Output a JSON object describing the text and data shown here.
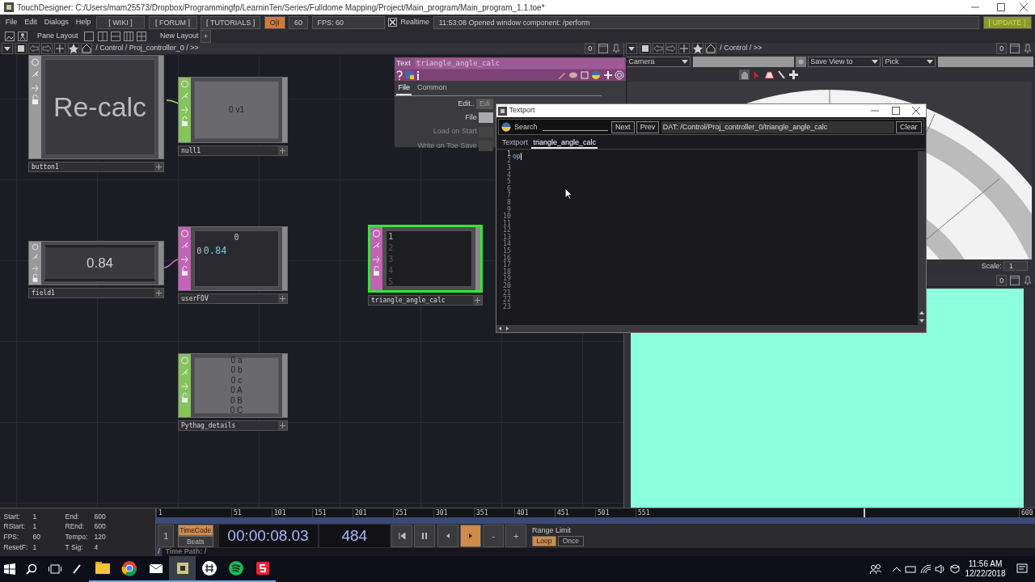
{
  "window": {
    "title": "TouchDesigner: C:/Users/mam25573/Dropbox/Programmingfp/LearninTen/Series/Fulldome Mapping/Project/Main_program/Main_program_1.1.toe*"
  },
  "menu": [
    "File",
    "Edit",
    "Dialogs",
    "Help"
  ],
  "toolbar": {
    "links": [
      "[ WIKI ]",
      "[ FORUM ]",
      "[ TUTORIALS ]"
    ],
    "perform_toggle": "O|I",
    "fps_limit": "60",
    "fps": "FPS:  60",
    "realtime": {
      "label": "Realtime",
      "checked": true
    },
    "message": "11:53:08 Opened window component: /perform",
    "update": "[ UPDATE ]"
  },
  "layout_bar": {
    "pane_layout": "Pane Layout",
    "new_layout": "New Layout",
    "add": "+"
  },
  "network": {
    "path": "/ Control / Proj_controller_0 / >>",
    "counter": "0",
    "nodes": [
      {
        "name": "button1",
        "kind": "button",
        "color": "#9a9a9a",
        "selected": false,
        "text": "Re-calc"
      },
      {
        "name": "null1",
        "kind": "chop",
        "color": "#86c35a",
        "selected": false,
        "lines": [
          "0 v1"
        ]
      },
      {
        "name": "field1",
        "kind": "field",
        "color": "#9a9a9a",
        "selected": false,
        "text": "0.84"
      },
      {
        "name": "userFOV",
        "kind": "table",
        "color": "#c263b5",
        "selected": false,
        "header": "0",
        "index": "0",
        "text": "0.84"
      },
      {
        "name": "triangle_angle_calc",
        "kind": "text",
        "color": "#c263b5",
        "selected": true,
        "lines": [
          "1",
          "2",
          "3",
          "4",
          "5"
        ]
      },
      {
        "name": "Pythag_details",
        "kind": "chop",
        "color": "#86c35a",
        "selected": false,
        "lines": [
          "0 a",
          "0 b",
          "0 c",
          "0 A",
          "0 B",
          "0 C"
        ]
      }
    ]
  },
  "parameters": {
    "type": "Text",
    "name": "triangle_angle_calc",
    "tabs": [
      {
        "label": "File",
        "selected": true
      },
      {
        "label": "Common",
        "selected": false
      }
    ],
    "rows": [
      {
        "label": "Edit..",
        "kind": "button",
        "value": "Edi",
        "disabled": false
      },
      {
        "label": "File",
        "kind": "field",
        "disabled": false
      },
      {
        "label": "Load on Start",
        "kind": "toggle",
        "disabled": true
      },
      {
        "label": "Write on Toe Save",
        "kind": "toggle",
        "disabled": true
      }
    ]
  },
  "viewer": {
    "path": "/ Control / >>",
    "counter": "0",
    "camera": "Camera",
    "save_view": "Save View to",
    "pick": "Pick",
    "scale_label": "Scale:",
    "scale": "1",
    "lower_counter": "0"
  },
  "textport": {
    "title": "Textport",
    "search_label": "Search",
    "next": "Next",
    "prev": "Prev",
    "dat_path": "DAT:  /Control/Proj_controller_0/triangle_angle_calc",
    "clear": "Clear",
    "tabs": [
      {
        "label": "Textport",
        "selected": false
      },
      {
        "label": "triangle_angle_calc",
        "selected": true
      }
    ],
    "line_numbers": [
      "1",
      "2",
      "3",
      "4",
      "5",
      "6",
      "7",
      "8",
      "9",
      "10",
      "11",
      "12",
      "13",
      "14",
      "15",
      "16",
      "17",
      "18",
      "19",
      "20",
      "21",
      "22",
      "23"
    ],
    "code": "op"
  },
  "timeline": {
    "info": [
      {
        "label": "Start:",
        "value": "1"
      },
      {
        "label": "End:",
        "value": "600"
      },
      {
        "label": "RStart:",
        "value": "1"
      },
      {
        "label": "REnd:",
        "value": "600"
      },
      {
        "label": "FPS:",
        "value": "60"
      },
      {
        "label": "Tempo:",
        "value": "120"
      },
      {
        "label": "ResetF:",
        "value": "1"
      },
      {
        "label": "T Sig:",
        "value": "4"
      }
    ],
    "ruler": [
      "1",
      "51",
      "101",
      "151",
      "201",
      "251",
      "301",
      "351",
      "401",
      "451",
      "501",
      "551",
      "600"
    ],
    "playhead": {
      "level": 0.805
    },
    "start_field": "1",
    "modes": [
      {
        "label": "TimeCode",
        "selected": true
      },
      {
        "label": "Beats",
        "selected": false
      }
    ],
    "timecode": "00:00:08.03",
    "frame": "484",
    "transport": [
      {
        "kind": "rewind",
        "selected": false
      },
      {
        "kind": "pause",
        "selected": false
      },
      {
        "kind": "step_back",
        "selected": false
      },
      {
        "kind": "play",
        "selected": true
      },
      {
        "kind": "text",
        "label": "-",
        "selected": false
      },
      {
        "kind": "text",
        "label": "+",
        "selected": false
      }
    ],
    "range_limit": "Range Limit",
    "range_modes": [
      {
        "label": "Loop",
        "selected": true
      },
      {
        "label": "Once",
        "selected": false
      }
    ],
    "root_button": "/",
    "time_path": "Time Path: /"
  },
  "taskbar": {
    "apps": [
      {
        "kind": "files",
        "selected": false
      },
      {
        "kind": "browser",
        "selected": false
      },
      {
        "kind": "mail",
        "selected": false
      },
      {
        "kind": "touchdesigner",
        "selected": true
      },
      {
        "kind": "chat",
        "selected": false
      },
      {
        "kind": "music",
        "selected": false
      },
      {
        "kind": "slides",
        "selected": false
      }
    ],
    "clock": "11:56 AM",
    "date": "12/22/2018"
  }
}
